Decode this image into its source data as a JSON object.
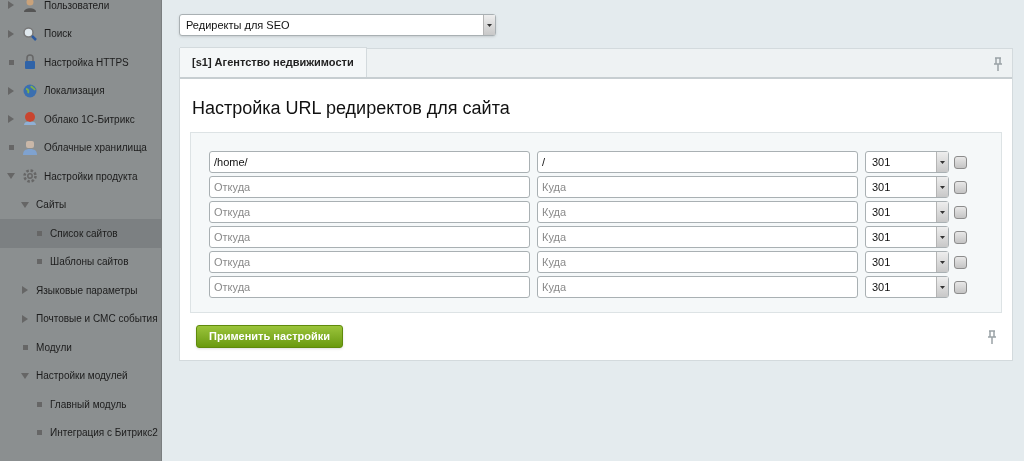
{
  "sidebar": {
    "items": [
      {
        "label": "Пользователи",
        "kind": "branch",
        "expanded": false,
        "selected": false
      },
      {
        "label": "Поиск",
        "kind": "branch",
        "expanded": false,
        "selected": false
      },
      {
        "label": "Настройка HTTPS",
        "kind": "leaf",
        "selected": false
      },
      {
        "label": "Локализация",
        "kind": "branch",
        "expanded": false,
        "selected": false
      },
      {
        "label": "Облако 1С-Битрикс",
        "kind": "branch",
        "expanded": false,
        "selected": false
      },
      {
        "label": "Облачные хранилища",
        "kind": "leaf",
        "selected": false
      },
      {
        "label": "Настройки продукта",
        "kind": "branch",
        "expanded": true,
        "selected": false,
        "children": [
          {
            "label": "Сайты",
            "kind": "branch",
            "expanded": true,
            "selected": false,
            "children": [
              {
                "label": "Список сайтов",
                "kind": "leaf",
                "selected": true
              },
              {
                "label": "Шаблоны сайтов",
                "kind": "leaf",
                "selected": false
              }
            ]
          },
          {
            "label": "Языковые параметры",
            "kind": "branch",
            "expanded": false,
            "selected": false
          },
          {
            "label": "Почтовые и СМС события",
            "kind": "branch",
            "expanded": false,
            "selected": false
          },
          {
            "label": "Модули",
            "kind": "leaf",
            "selected": false
          },
          {
            "label": "Настройки модулей",
            "kind": "branch",
            "expanded": true,
            "selected": false,
            "children": [
              {
                "label": "Главный модуль",
                "kind": "leaf",
                "selected": false
              },
              {
                "label": "Интеграция с Битрикс2",
                "kind": "leaf",
                "selected": false
              }
            ]
          }
        ]
      }
    ]
  },
  "module_select": {
    "value": "Редиректы для SEO"
  },
  "tabs": [
    {
      "label": "[s1] Агентство недвижимости",
      "selected": true
    }
  ],
  "heading": "Настройка URL редиректов для сайта",
  "redirects": [
    {
      "from": {
        "value": "/home/"
      },
      "to": {
        "value": "/"
      },
      "code": "301",
      "checked": false
    },
    {
      "from": {
        "placeholder": "Откуда"
      },
      "to": {
        "placeholder": "Куда"
      },
      "code": "301",
      "checked": false
    },
    {
      "from": {
        "placeholder": "Откуда"
      },
      "to": {
        "placeholder": "Куда"
      },
      "code": "301",
      "checked": false
    },
    {
      "from": {
        "placeholder": "Откуда"
      },
      "to": {
        "placeholder": "Куда"
      },
      "code": "301",
      "checked": false
    },
    {
      "from": {
        "placeholder": "Откуда"
      },
      "to": {
        "placeholder": "Куда"
      },
      "code": "301",
      "checked": false
    },
    {
      "from": {
        "placeholder": "Откуда"
      },
      "to": {
        "placeholder": "Куда"
      },
      "code": "301",
      "checked": false
    }
  ],
  "apply_button": "Применить настройки"
}
